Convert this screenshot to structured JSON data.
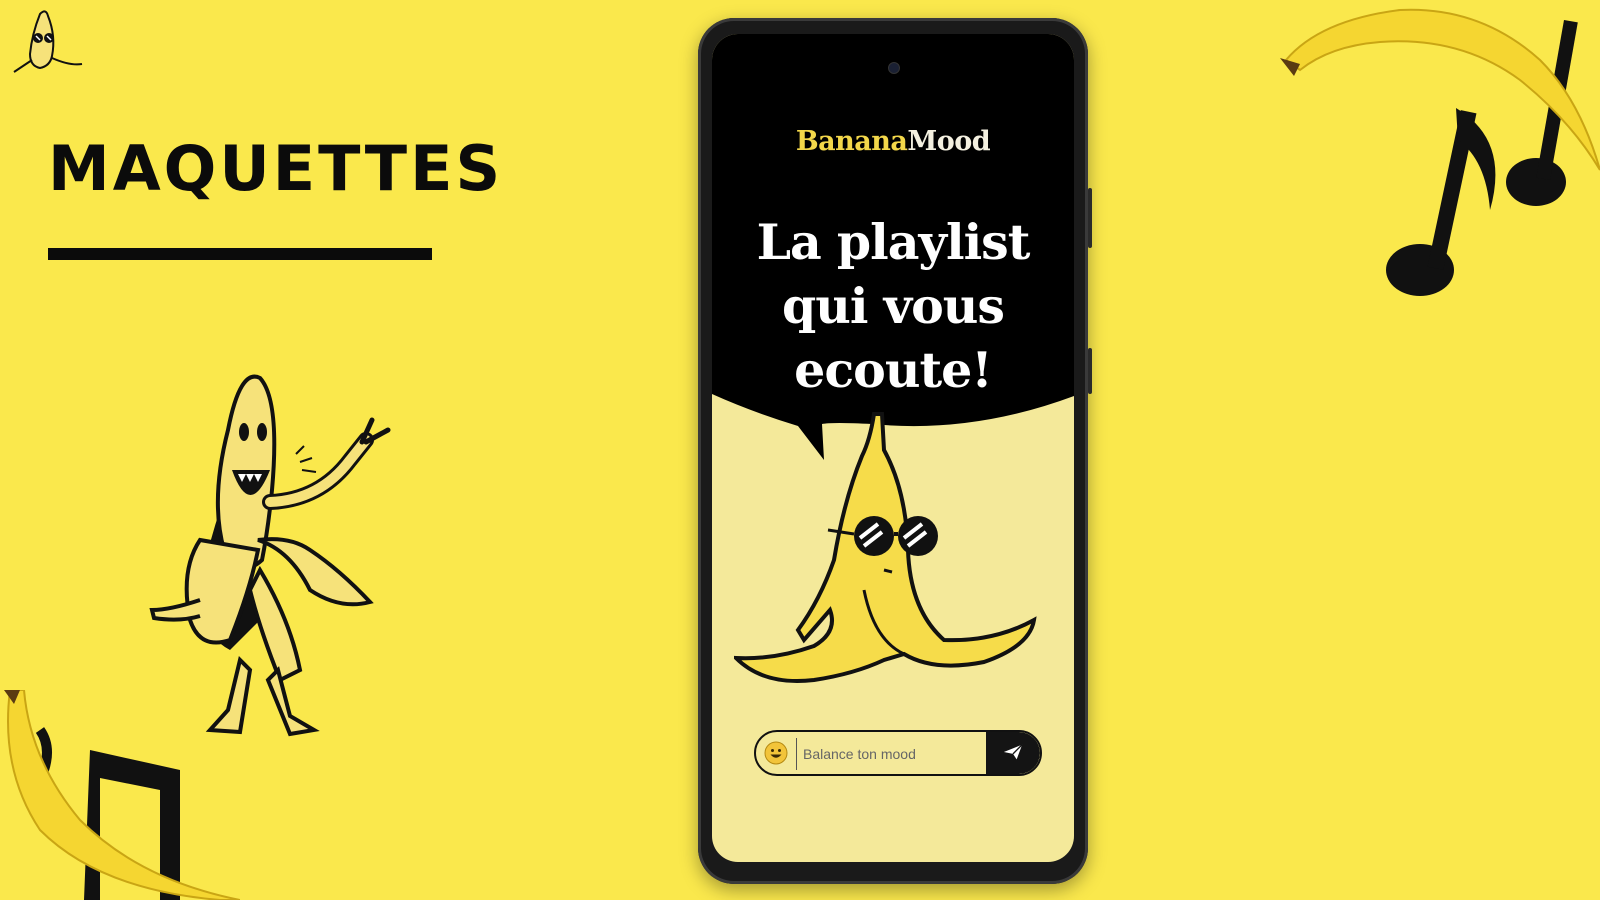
{
  "slide": {
    "title": "MAQUETTES"
  },
  "app": {
    "brand_part1": "Banana",
    "brand_part2": "Mood",
    "headline_line1": "La playlist",
    "headline_line2": "qui vous",
    "headline_line3": "ecoute!",
    "mood_input": {
      "placeholder": "Balance ton mood",
      "value": ""
    },
    "icons": {
      "emoji": "smiley-face-icon",
      "send": "paper-plane-icon"
    }
  },
  "colors": {
    "background": "#fae84c",
    "dark": "#0b0b0b",
    "screen_bg": "#f4e99a",
    "brand_yellow": "#f3d74a"
  }
}
